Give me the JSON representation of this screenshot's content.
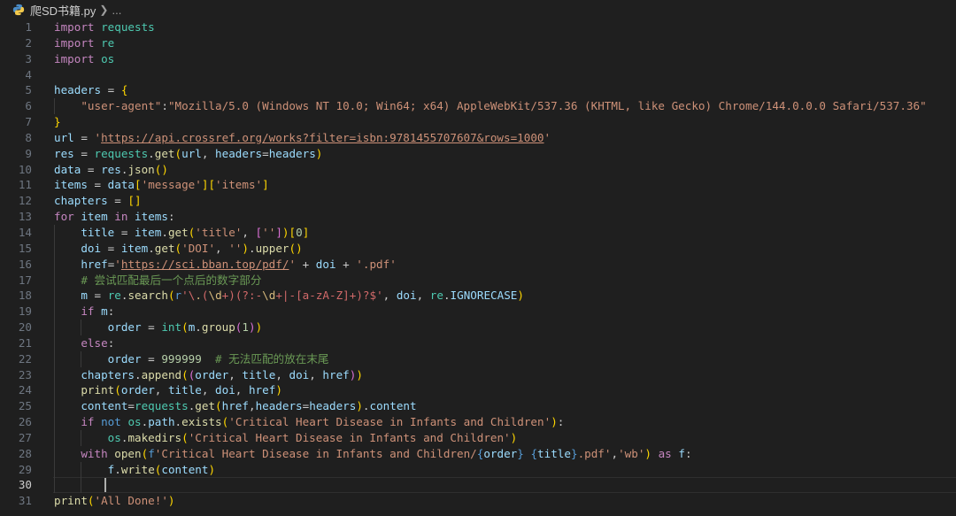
{
  "breadcrumb": {
    "file_name": "爬SD书籍.py",
    "more": "..."
  },
  "editor": {
    "active_line": 30,
    "lines": [
      [
        [
          "kw",
          "import "
        ],
        [
          "cls",
          "requests"
        ]
      ],
      [
        [
          "kw",
          "import "
        ],
        [
          "cls",
          "re"
        ]
      ],
      [
        [
          "kw",
          "import "
        ],
        [
          "cls",
          "os"
        ]
      ],
      [],
      [
        [
          "var",
          "headers"
        ],
        [
          "pn",
          " = "
        ],
        [
          "br1",
          "{"
        ]
      ],
      [
        [
          "pn",
          "    "
        ],
        [
          "st",
          "\"user-agent\""
        ],
        [
          "pn",
          ":"
        ],
        [
          "st",
          "\"Mozilla/5.0 (Windows NT 10.0; Win64; x64) AppleWebKit/537.36 (KHTML, like Gecko) Chrome/144.0.0.0 Safari/537.36\""
        ]
      ],
      [
        [
          "br1",
          "}"
        ]
      ],
      [
        [
          "var",
          "url"
        ],
        [
          "pn",
          " = "
        ],
        [
          "st",
          "'"
        ],
        [
          "st url",
          "https://api.crossref.org/works?filter=isbn:9781455707607&rows=1000"
        ],
        [
          "st",
          "'"
        ]
      ],
      [
        [
          "var",
          "res"
        ],
        [
          "pn",
          " = "
        ],
        [
          "cls",
          "requests"
        ],
        [
          "pn",
          "."
        ],
        [
          "fn",
          "get"
        ],
        [
          "br1",
          "("
        ],
        [
          "var",
          "url"
        ],
        [
          "pn",
          ", "
        ],
        [
          "var",
          "headers"
        ],
        [
          "pn",
          "="
        ],
        [
          "var",
          "headers"
        ],
        [
          "br1",
          ")"
        ]
      ],
      [
        [
          "var",
          "data"
        ],
        [
          "pn",
          " = "
        ],
        [
          "var",
          "res"
        ],
        [
          "pn",
          "."
        ],
        [
          "fn",
          "json"
        ],
        [
          "br1",
          "()"
        ]
      ],
      [
        [
          "var",
          "items"
        ],
        [
          "pn",
          " = "
        ],
        [
          "var",
          "data"
        ],
        [
          "br1",
          "["
        ],
        [
          "st",
          "'message'"
        ],
        [
          "br1",
          "]["
        ],
        [
          "st",
          "'items'"
        ],
        [
          "br1",
          "]"
        ]
      ],
      [
        [
          "var",
          "chapters"
        ],
        [
          "pn",
          " = "
        ],
        [
          "br1",
          "[]"
        ]
      ],
      [
        [
          "kw",
          "for "
        ],
        [
          "var",
          "item"
        ],
        [
          "kw",
          " in "
        ],
        [
          "var",
          "items"
        ],
        [
          "pn",
          ":"
        ]
      ],
      [
        [
          "pn",
          "    "
        ],
        [
          "var",
          "title"
        ],
        [
          "pn",
          " = "
        ],
        [
          "var",
          "item"
        ],
        [
          "pn",
          "."
        ],
        [
          "fn",
          "get"
        ],
        [
          "br1",
          "("
        ],
        [
          "st",
          "'title'"
        ],
        [
          "pn",
          ", "
        ],
        [
          "br2",
          "["
        ],
        [
          "st",
          "''"
        ],
        [
          "br2",
          "]"
        ],
        [
          "br1",
          ")"
        ],
        [
          "br1",
          "["
        ],
        [
          "num",
          "0"
        ],
        [
          "br1",
          "]"
        ]
      ],
      [
        [
          "pn",
          "    "
        ],
        [
          "var",
          "doi"
        ],
        [
          "pn",
          " = "
        ],
        [
          "var",
          "item"
        ],
        [
          "pn",
          "."
        ],
        [
          "fn",
          "get"
        ],
        [
          "br1",
          "("
        ],
        [
          "st",
          "'DOI'"
        ],
        [
          "pn",
          ", "
        ],
        [
          "st",
          "''"
        ],
        [
          "br1",
          ")"
        ],
        [
          "pn",
          "."
        ],
        [
          "fn",
          "upper"
        ],
        [
          "br1",
          "()"
        ]
      ],
      [
        [
          "pn",
          "    "
        ],
        [
          "var",
          "href"
        ],
        [
          "pn",
          "="
        ],
        [
          "st",
          "'"
        ],
        [
          "st url",
          "https://sci.bban.top/pdf/"
        ],
        [
          "st",
          "'"
        ],
        [
          "pn",
          " + "
        ],
        [
          "var",
          "doi"
        ],
        [
          "pn",
          " + "
        ],
        [
          "st",
          "'.pdf'"
        ]
      ],
      [
        [
          "pn",
          "    "
        ],
        [
          "cm",
          "# 尝试匹配最后一个点后的数字部分"
        ]
      ],
      [
        [
          "pn",
          "    "
        ],
        [
          "var",
          "m"
        ],
        [
          "pn",
          " = "
        ],
        [
          "cls",
          "re"
        ],
        [
          "pn",
          "."
        ],
        [
          "fn",
          "search"
        ],
        [
          "br1",
          "("
        ],
        [
          "kb",
          "r"
        ],
        [
          "rx",
          "'\\"
        ],
        [
          "esc",
          "."
        ],
        [
          "rx",
          "("
        ],
        [
          "esc",
          "\\d"
        ],
        [
          "rx",
          "+)(?:-"
        ],
        [
          "esc",
          "\\d"
        ],
        [
          "rx",
          "+|-[a-zA-Z]+)?$'"
        ],
        [
          "pn",
          ", "
        ],
        [
          "var",
          "doi"
        ],
        [
          "pn",
          ", "
        ],
        [
          "cls",
          "re"
        ],
        [
          "pn",
          "."
        ],
        [
          "var",
          "IGNORECASE"
        ],
        [
          "br1",
          ")"
        ]
      ],
      [
        [
          "pn",
          "    "
        ],
        [
          "kw",
          "if "
        ],
        [
          "var",
          "m"
        ],
        [
          "pn",
          ":"
        ]
      ],
      [
        [
          "pn",
          "        "
        ],
        [
          "var",
          "order"
        ],
        [
          "pn",
          " = "
        ],
        [
          "cls",
          "int"
        ],
        [
          "br1",
          "("
        ],
        [
          "var",
          "m"
        ],
        [
          "pn",
          "."
        ],
        [
          "fn",
          "group"
        ],
        [
          "br2",
          "("
        ],
        [
          "num",
          "1"
        ],
        [
          "br2",
          ")"
        ],
        [
          "br1",
          ")"
        ]
      ],
      [
        [
          "pn",
          "    "
        ],
        [
          "kw",
          "else"
        ],
        [
          "pn",
          ":"
        ]
      ],
      [
        [
          "pn",
          "        "
        ],
        [
          "var",
          "order"
        ],
        [
          "pn",
          " = "
        ],
        [
          "num",
          "999999"
        ],
        [
          "pn",
          "  "
        ],
        [
          "cm",
          "# 无法匹配的放在末尾"
        ]
      ],
      [
        [
          "pn",
          "    "
        ],
        [
          "var",
          "chapters"
        ],
        [
          "pn",
          "."
        ],
        [
          "fn",
          "append"
        ],
        [
          "br1",
          "("
        ],
        [
          "br2",
          "("
        ],
        [
          "var",
          "order"
        ],
        [
          "pn",
          ", "
        ],
        [
          "var",
          "title"
        ],
        [
          "pn",
          ", "
        ],
        [
          "var",
          "doi"
        ],
        [
          "pn",
          ", "
        ],
        [
          "var",
          "href"
        ],
        [
          "br2",
          ")"
        ],
        [
          "br1",
          ")"
        ]
      ],
      [
        [
          "pn",
          "    "
        ],
        [
          "fn",
          "print"
        ],
        [
          "br1",
          "("
        ],
        [
          "var",
          "order"
        ],
        [
          "pn",
          ", "
        ],
        [
          "var",
          "title"
        ],
        [
          "pn",
          ", "
        ],
        [
          "var",
          "doi"
        ],
        [
          "pn",
          ", "
        ],
        [
          "var",
          "href"
        ],
        [
          "br1",
          ")"
        ]
      ],
      [
        [
          "pn",
          "    "
        ],
        [
          "var",
          "content"
        ],
        [
          "pn",
          "="
        ],
        [
          "cls",
          "requests"
        ],
        [
          "pn",
          "."
        ],
        [
          "fn",
          "get"
        ],
        [
          "br1",
          "("
        ],
        [
          "var",
          "href"
        ],
        [
          "pn",
          ","
        ],
        [
          "var",
          "headers"
        ],
        [
          "pn",
          "="
        ],
        [
          "var",
          "headers"
        ],
        [
          "br1",
          ")"
        ],
        [
          "pn",
          "."
        ],
        [
          "var",
          "content"
        ]
      ],
      [
        [
          "pn",
          "    "
        ],
        [
          "kw",
          "if "
        ],
        [
          "kb",
          "not "
        ],
        [
          "cls",
          "os"
        ],
        [
          "pn",
          "."
        ],
        [
          "var",
          "path"
        ],
        [
          "pn",
          "."
        ],
        [
          "fn",
          "exists"
        ],
        [
          "br1",
          "("
        ],
        [
          "st",
          "'Critical Heart Disease in Infants and Children'"
        ],
        [
          "br1",
          ")"
        ],
        [
          "pn",
          ":"
        ]
      ],
      [
        [
          "pn",
          "        "
        ],
        [
          "cls",
          "os"
        ],
        [
          "pn",
          "."
        ],
        [
          "fn",
          "makedirs"
        ],
        [
          "br1",
          "("
        ],
        [
          "st",
          "'Critical Heart Disease in Infants and Children'"
        ],
        [
          "br1",
          ")"
        ]
      ],
      [
        [
          "pn",
          "    "
        ],
        [
          "kw",
          "with "
        ],
        [
          "fn",
          "open"
        ],
        [
          "br1",
          "("
        ],
        [
          "kb",
          "f"
        ],
        [
          "st",
          "'Critical Heart Disease in Infants and Children/"
        ],
        [
          "kb",
          "{"
        ],
        [
          "var",
          "order"
        ],
        [
          "kb",
          "}"
        ],
        [
          "st",
          " "
        ],
        [
          "kb",
          "{"
        ],
        [
          "var",
          "title"
        ],
        [
          "kb",
          "}"
        ],
        [
          "st",
          ".pdf'"
        ],
        [
          "pn",
          ","
        ],
        [
          "st",
          "'wb'"
        ],
        [
          "br1",
          ")"
        ],
        [
          "kw",
          " as "
        ],
        [
          "var",
          "f"
        ],
        [
          "pn",
          ":"
        ]
      ],
      [
        [
          "pn",
          "        "
        ],
        [
          "var",
          "f"
        ],
        [
          "pn",
          "."
        ],
        [
          "fn",
          "write"
        ],
        [
          "br1",
          "("
        ],
        [
          "var",
          "content"
        ],
        [
          "br1",
          ")"
        ]
      ],
      [],
      [
        [
          "fn",
          "print"
        ],
        [
          "br1",
          "("
        ],
        [
          "st",
          "'All Done!'"
        ],
        [
          "br1",
          ")"
        ]
      ]
    ]
  }
}
